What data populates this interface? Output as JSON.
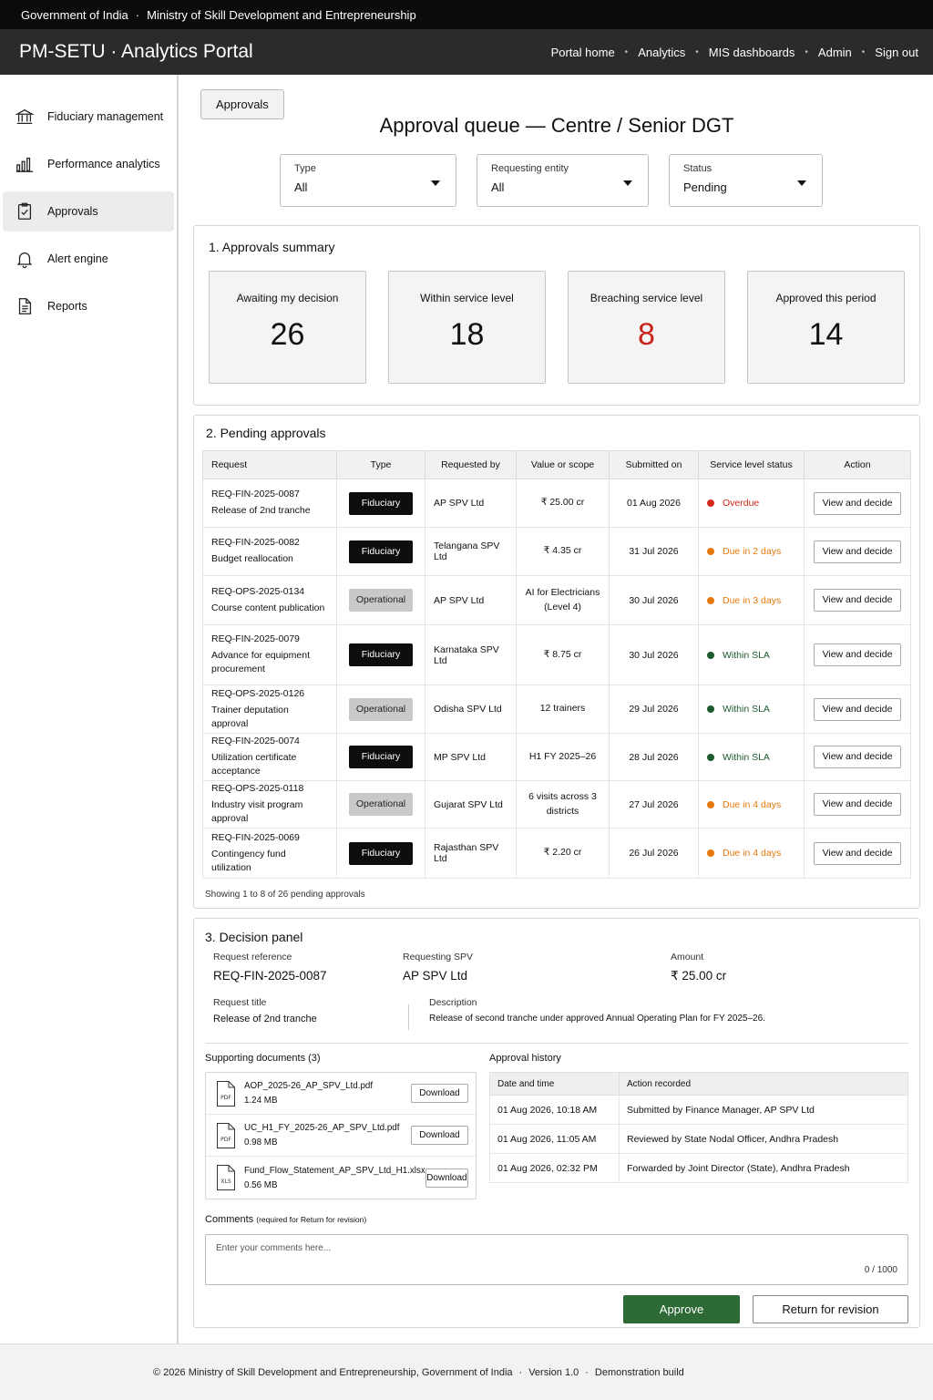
{
  "gov_bar": {
    "left": "Government of India",
    "right": "Ministry of Skill Development and Entrepreneurship"
  },
  "app_bar": {
    "title": "PM-SETU · Analytics Portal",
    "nav": [
      "Portal home",
      "Analytics",
      "MIS dashboards",
      "Admin",
      "Sign out"
    ]
  },
  "sidebar": {
    "items": [
      {
        "label": "Fiduciary management",
        "icon": "bank-icon"
      },
      {
        "label": "Performance analytics",
        "icon": "bar-chart-icon"
      },
      {
        "label": "Approvals",
        "icon": "clipboard-check-icon",
        "active": true
      },
      {
        "label": "Alert engine",
        "icon": "bell-icon"
      },
      {
        "label": "Reports",
        "icon": "document-icon"
      }
    ]
  },
  "breadcrumb": "Approvals",
  "page_title": "Approval queue — Centre / Senior DGT",
  "filters": [
    {
      "label": "Type",
      "value": "All"
    },
    {
      "label": "Requesting entity",
      "value": "All"
    },
    {
      "label": "Status",
      "value": "Pending"
    }
  ],
  "summary": {
    "title": "1.  Approvals summary",
    "cards": [
      {
        "label": "Awaiting my decision",
        "value": "26"
      },
      {
        "label": "Within service level",
        "value": "18"
      },
      {
        "label": "Breaching service level",
        "value": "8",
        "color": "#c8231b"
      },
      {
        "label": "Approved this period",
        "value": "14"
      }
    ]
  },
  "pending": {
    "title": "2.  Pending approvals",
    "columns": [
      "Request",
      "Type",
      "Requested by",
      "Value or scope",
      "Submitted on",
      "Service level status",
      "Action"
    ],
    "rows": [
      {
        "id": "REQ-FIN-2025-0087",
        "title": "Release of 2nd tranche",
        "type": "Fiduciary",
        "by": "AP SPV Ltd",
        "value": "₹ 25.00 cr",
        "date": "01 Aug 2026",
        "status": "Overdue",
        "status_color": "#d42a1a",
        "action": "View and decide"
      },
      {
        "id": "REQ-FIN-2025-0082",
        "title": "Budget reallocation",
        "type": "Fiduciary",
        "by": "Telangana SPV Ltd",
        "value": "₹ 4.35 cr",
        "date": "31 Jul 2026",
        "status": "Due in 2 days",
        "status_color": "#e8780a",
        "action": "View and decide"
      },
      {
        "id": "REQ-OPS-2025-0134",
        "title": "Course content publication",
        "type": "Operational",
        "by": "AP SPV Ltd",
        "value": "AI for Electricians (Level 4)",
        "date": "30 Jul 2026",
        "status": "Due in 3 days",
        "status_color": "#e8780a",
        "action": "View and decide"
      },
      {
        "id": "REQ-FIN-2025-0079",
        "title": "Advance for equipment procurement",
        "type": "Fiduciary",
        "by": "Karnataka SPV Ltd",
        "value": "₹ 8.75 cr",
        "date": "30 Jul 2026",
        "status": "Within SLA",
        "status_color": "#1d5a2e",
        "action": "View and decide"
      },
      {
        "id": "REQ-OPS-2025-0126",
        "title": "Trainer deputation approval",
        "type": "Operational",
        "by": "Odisha SPV Ltd",
        "value": "12 trainers",
        "date": "29 Jul 2026",
        "status": "Within SLA",
        "status_color": "#1d5a2e",
        "action": "View and decide"
      },
      {
        "id": "REQ-FIN-2025-0074",
        "title": "Utilization certificate acceptance",
        "type": "Fiduciary",
        "by": "MP SPV Ltd",
        "value": "H1 FY 2025–26",
        "date": "28 Jul 2026",
        "status": "Within SLA",
        "status_color": "#1d5a2e",
        "action": "View and decide"
      },
      {
        "id": "REQ-OPS-2025-0118",
        "title": "Industry visit program approval",
        "type": "Operational",
        "by": "Gujarat SPV Ltd",
        "value": "6 visits across 3 districts",
        "date": "27 Jul 2026",
        "status": "Due in 4 days",
        "status_color": "#e8780a",
        "action": "View and decide"
      },
      {
        "id": "REQ-FIN-2025-0069",
        "title": "Contingency fund utilization",
        "type": "Fiduciary",
        "by": "Rajasthan SPV Ltd",
        "value": "₹ 2.20 cr",
        "date": "26 Jul 2026",
        "status": "Due in 4 days",
        "status_color": "#e8780a",
        "action": "View and decide"
      }
    ],
    "showing": "Showing 1 to 8 of 26 pending approvals"
  },
  "decision": {
    "title": "3.  Decision panel",
    "ref_label": "Request reference",
    "ref_value": "REQ-FIN-2025-0087",
    "spv_label": "Requesting SPV",
    "spv_value": "AP SPV Ltd",
    "amount_label": "Amount",
    "amount_value": "₹ 25.00 cr",
    "title_label": "Request title",
    "title_value": "Release of 2nd tranche",
    "desc_label": "Description",
    "desc_value": "Release of second tranche under approved Annual Operating Plan for FY 2025–26.",
    "docs_title": "Supporting documents (3)",
    "docs": [
      {
        "name": "AOP_2025-26_AP_SPV_Ltd.pdf",
        "size": "1.24 MB",
        "ext": "PDF",
        "action": "Download"
      },
      {
        "name": "UC_H1_FY_2025-26_AP_SPV_Ltd.pdf",
        "size": "0.98 MB",
        "ext": "PDF",
        "action": "Download"
      },
      {
        "name": "Fund_Flow_Statement_AP_SPV_Ltd_H1.xlsx",
        "size": "0.56 MB",
        "ext": "XLS",
        "action": "Download"
      }
    ],
    "history_title": "Approval history",
    "history_columns": [
      "Date and time",
      "Action recorded"
    ],
    "history": [
      {
        "when": "01 Aug 2026, 10:18 AM",
        "what": "Submitted by Finance Manager, AP SPV Ltd"
      },
      {
        "when": "01 Aug 2026, 11:05 AM",
        "what": "Reviewed by State Nodal Officer, Andhra Pradesh"
      },
      {
        "when": "01 Aug 2026, 02:32 PM",
        "what": "Forwarded by Joint Director (State), Andhra Pradesh"
      }
    ],
    "comments_label": "Comments",
    "comments_hint": "(required for Return for revision)",
    "comments_placeholder": "Enter your comments here...",
    "counter": "0 / 1000",
    "approve": "Approve",
    "return": "Return for revision"
  },
  "footer": {
    "copyright": "© 2026 Ministry of Skill Development and Entrepreneurship, Government of India",
    "version": "Version 1.0",
    "build": "Demonstration build"
  }
}
